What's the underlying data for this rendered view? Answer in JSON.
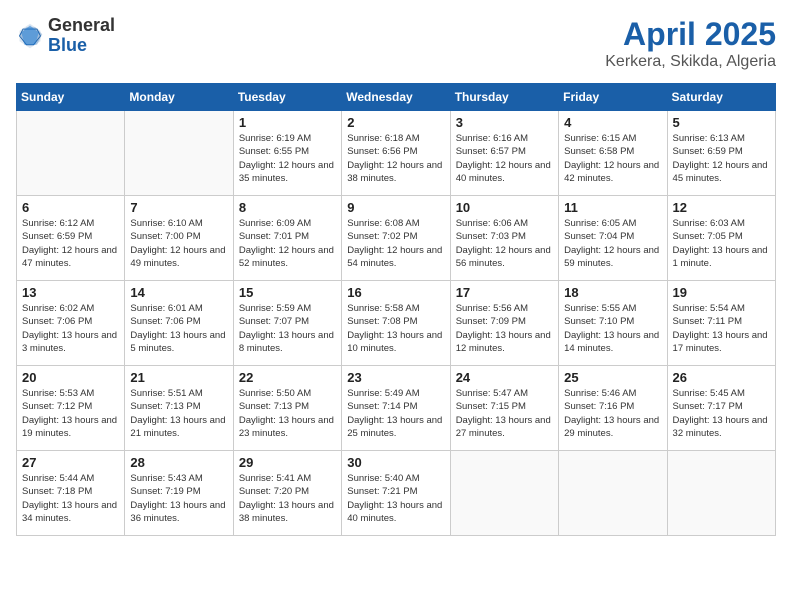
{
  "header": {
    "logo_general": "General",
    "logo_blue": "Blue",
    "title": "April 2025",
    "subtitle": "Kerkera, Skikda, Algeria"
  },
  "weekdays": [
    "Sunday",
    "Monday",
    "Tuesday",
    "Wednesday",
    "Thursday",
    "Friday",
    "Saturday"
  ],
  "weeks": [
    [
      {
        "day": "",
        "info": ""
      },
      {
        "day": "",
        "info": ""
      },
      {
        "day": "1",
        "info": "Sunrise: 6:19 AM\nSunset: 6:55 PM\nDaylight: 12 hours and 35 minutes."
      },
      {
        "day": "2",
        "info": "Sunrise: 6:18 AM\nSunset: 6:56 PM\nDaylight: 12 hours and 38 minutes."
      },
      {
        "day": "3",
        "info": "Sunrise: 6:16 AM\nSunset: 6:57 PM\nDaylight: 12 hours and 40 minutes."
      },
      {
        "day": "4",
        "info": "Sunrise: 6:15 AM\nSunset: 6:58 PM\nDaylight: 12 hours and 42 minutes."
      },
      {
        "day": "5",
        "info": "Sunrise: 6:13 AM\nSunset: 6:59 PM\nDaylight: 12 hours and 45 minutes."
      }
    ],
    [
      {
        "day": "6",
        "info": "Sunrise: 6:12 AM\nSunset: 6:59 PM\nDaylight: 12 hours and 47 minutes."
      },
      {
        "day": "7",
        "info": "Sunrise: 6:10 AM\nSunset: 7:00 PM\nDaylight: 12 hours and 49 minutes."
      },
      {
        "day": "8",
        "info": "Sunrise: 6:09 AM\nSunset: 7:01 PM\nDaylight: 12 hours and 52 minutes."
      },
      {
        "day": "9",
        "info": "Sunrise: 6:08 AM\nSunset: 7:02 PM\nDaylight: 12 hours and 54 minutes."
      },
      {
        "day": "10",
        "info": "Sunrise: 6:06 AM\nSunset: 7:03 PM\nDaylight: 12 hours and 56 minutes."
      },
      {
        "day": "11",
        "info": "Sunrise: 6:05 AM\nSunset: 7:04 PM\nDaylight: 12 hours and 59 minutes."
      },
      {
        "day": "12",
        "info": "Sunrise: 6:03 AM\nSunset: 7:05 PM\nDaylight: 13 hours and 1 minute."
      }
    ],
    [
      {
        "day": "13",
        "info": "Sunrise: 6:02 AM\nSunset: 7:06 PM\nDaylight: 13 hours and 3 minutes."
      },
      {
        "day": "14",
        "info": "Sunrise: 6:01 AM\nSunset: 7:06 PM\nDaylight: 13 hours and 5 minutes."
      },
      {
        "day": "15",
        "info": "Sunrise: 5:59 AM\nSunset: 7:07 PM\nDaylight: 13 hours and 8 minutes."
      },
      {
        "day": "16",
        "info": "Sunrise: 5:58 AM\nSunset: 7:08 PM\nDaylight: 13 hours and 10 minutes."
      },
      {
        "day": "17",
        "info": "Sunrise: 5:56 AM\nSunset: 7:09 PM\nDaylight: 13 hours and 12 minutes."
      },
      {
        "day": "18",
        "info": "Sunrise: 5:55 AM\nSunset: 7:10 PM\nDaylight: 13 hours and 14 minutes."
      },
      {
        "day": "19",
        "info": "Sunrise: 5:54 AM\nSunset: 7:11 PM\nDaylight: 13 hours and 17 minutes."
      }
    ],
    [
      {
        "day": "20",
        "info": "Sunrise: 5:53 AM\nSunset: 7:12 PM\nDaylight: 13 hours and 19 minutes."
      },
      {
        "day": "21",
        "info": "Sunrise: 5:51 AM\nSunset: 7:13 PM\nDaylight: 13 hours and 21 minutes."
      },
      {
        "day": "22",
        "info": "Sunrise: 5:50 AM\nSunset: 7:13 PM\nDaylight: 13 hours and 23 minutes."
      },
      {
        "day": "23",
        "info": "Sunrise: 5:49 AM\nSunset: 7:14 PM\nDaylight: 13 hours and 25 minutes."
      },
      {
        "day": "24",
        "info": "Sunrise: 5:47 AM\nSunset: 7:15 PM\nDaylight: 13 hours and 27 minutes."
      },
      {
        "day": "25",
        "info": "Sunrise: 5:46 AM\nSunset: 7:16 PM\nDaylight: 13 hours and 29 minutes."
      },
      {
        "day": "26",
        "info": "Sunrise: 5:45 AM\nSunset: 7:17 PM\nDaylight: 13 hours and 32 minutes."
      }
    ],
    [
      {
        "day": "27",
        "info": "Sunrise: 5:44 AM\nSunset: 7:18 PM\nDaylight: 13 hours and 34 minutes."
      },
      {
        "day": "28",
        "info": "Sunrise: 5:43 AM\nSunset: 7:19 PM\nDaylight: 13 hours and 36 minutes."
      },
      {
        "day": "29",
        "info": "Sunrise: 5:41 AM\nSunset: 7:20 PM\nDaylight: 13 hours and 38 minutes."
      },
      {
        "day": "30",
        "info": "Sunrise: 5:40 AM\nSunset: 7:21 PM\nDaylight: 13 hours and 40 minutes."
      },
      {
        "day": "",
        "info": ""
      },
      {
        "day": "",
        "info": ""
      },
      {
        "day": "",
        "info": ""
      }
    ]
  ]
}
